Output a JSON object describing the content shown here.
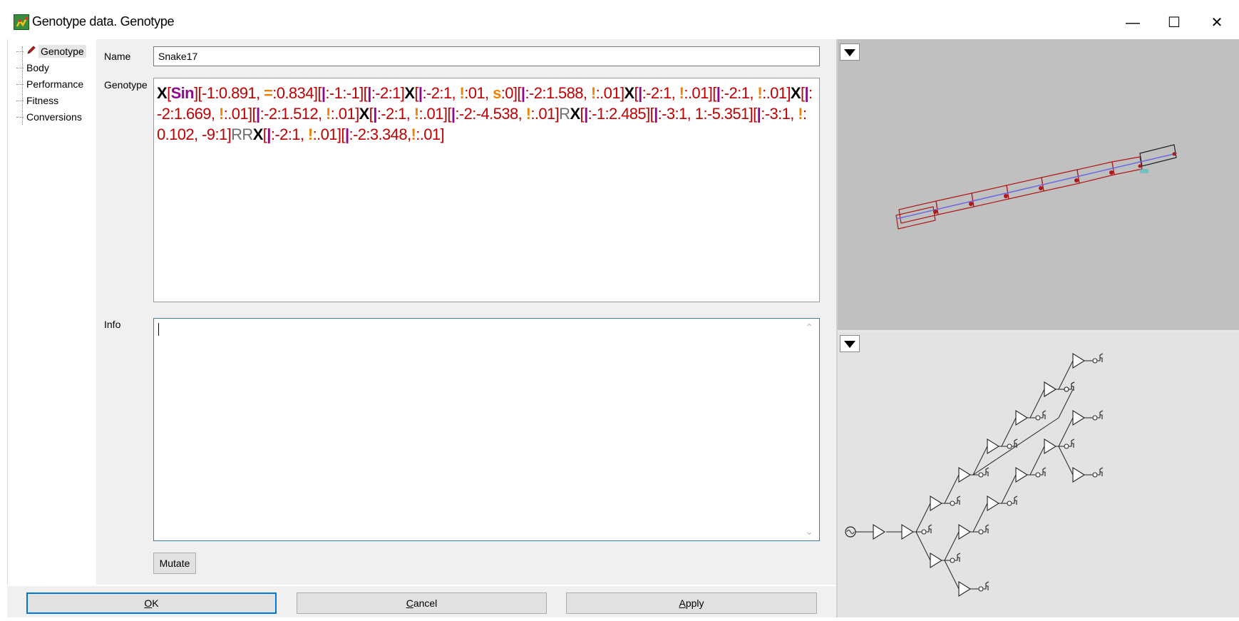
{
  "window": {
    "title": "Genotype data. Genotype",
    "minimize_glyph": "—",
    "maximize_glyph": "☐",
    "close_glyph": "✕"
  },
  "tree": {
    "items": [
      {
        "label": "Genotype",
        "selected": true,
        "icon": "pencil-icon"
      },
      {
        "label": "Body"
      },
      {
        "label": "Performance"
      },
      {
        "label": "Fitness"
      },
      {
        "label": "Conversions"
      }
    ]
  },
  "form": {
    "name_label": "Name",
    "name_value": "Snake17",
    "genotype_label": "Genotype",
    "info_label": "Info",
    "info_value": "",
    "mutate_label": "Mutate"
  },
  "genotype_tokens": [
    [
      "x",
      "X"
    ],
    [
      "n",
      "["
    ],
    [
      "p",
      "Sin"
    ],
    [
      "n",
      "][-1:0.891, "
    ],
    [
      "o",
      "="
    ],
    [
      "n",
      ":0.834]["
    ],
    [
      "p",
      "|"
    ],
    [
      "n",
      ":-1:-1]["
    ],
    [
      "p",
      "|"
    ],
    [
      "n",
      ":-2:1]"
    ],
    [
      "x",
      "X"
    ],
    [
      "n",
      "["
    ],
    [
      "p",
      "|"
    ],
    [
      "n",
      ":-2:1, "
    ],
    [
      "o",
      "!"
    ],
    [
      "n",
      ":01, "
    ],
    [
      "o",
      "s"
    ],
    [
      "n",
      ":0]["
    ],
    [
      "p",
      "|"
    ],
    [
      "n",
      ":-2:1.588, "
    ],
    [
      "o",
      "!"
    ],
    [
      "n",
      ":.01]"
    ],
    [
      "x",
      "X"
    ],
    [
      "n",
      "["
    ],
    [
      "p",
      "|"
    ],
    [
      "n",
      ":-2:1, "
    ],
    [
      "o",
      "!"
    ],
    [
      "n",
      ":.01]["
    ],
    [
      "p",
      "|"
    ],
    [
      "n",
      ":-2:1, "
    ],
    [
      "o",
      "!"
    ],
    [
      "n",
      ":.01]"
    ],
    [
      "x",
      "X"
    ],
    [
      "n",
      "["
    ],
    [
      "p",
      "|"
    ],
    [
      "n",
      ":-2:1.669, "
    ],
    [
      "o",
      "!"
    ],
    [
      "n",
      ":.01]["
    ],
    [
      "p",
      "|"
    ],
    [
      "n",
      ":-2:1.512, "
    ],
    [
      "o",
      "!"
    ],
    [
      "n",
      ":.01]"
    ],
    [
      "x",
      "X"
    ],
    [
      "n",
      "["
    ],
    [
      "p",
      "|"
    ],
    [
      "n",
      ":-2:1, "
    ],
    [
      "o",
      "!"
    ],
    [
      "n",
      ":.01]["
    ],
    [
      "p",
      "|"
    ],
    [
      "n",
      ":-2:-4.538, "
    ],
    [
      "o",
      "!"
    ],
    [
      "n",
      ":.01]"
    ],
    [
      "g",
      "R"
    ],
    [
      "x",
      "X"
    ],
    [
      "n",
      "["
    ],
    [
      "p",
      "|"
    ],
    [
      "n",
      ":-1:2.485]["
    ],
    [
      "p",
      "|"
    ],
    [
      "n",
      ":-3:1, 1:-5.351]["
    ],
    [
      "p",
      "|"
    ],
    [
      "n",
      ":-3:1, "
    ],
    [
      "o",
      "!"
    ],
    [
      "n",
      ":0.102, -9:1]"
    ],
    [
      "g",
      "RR"
    ],
    [
      "x",
      "X"
    ],
    [
      "n",
      "["
    ],
    [
      "p",
      "|"
    ],
    [
      "n",
      ":-2:1, "
    ],
    [
      "o",
      "!"
    ],
    [
      "n",
      ":.01]["
    ],
    [
      "p",
      "|"
    ],
    [
      "n",
      ":-2:3.348,"
    ],
    [
      "o",
      "!"
    ],
    [
      "n",
      ":.01]"
    ]
  ],
  "buttons": {
    "ok_label_u": "O",
    "ok_label_rest": "K",
    "cancel_label_u": "C",
    "cancel_label_rest": "ancel",
    "apply_label_u": "A",
    "apply_label_rest": "pply"
  },
  "colors": {
    "genotype_number": "#c00000",
    "genotype_part": "#8b0a8b",
    "genotype_modifier": "#f08000",
    "genotype_joint": "#000000",
    "body_segment": "#b01818",
    "body_axis": "#6a6ae0",
    "view_background": "#c0c0c0",
    "brain_background": "#e3e3e3"
  }
}
